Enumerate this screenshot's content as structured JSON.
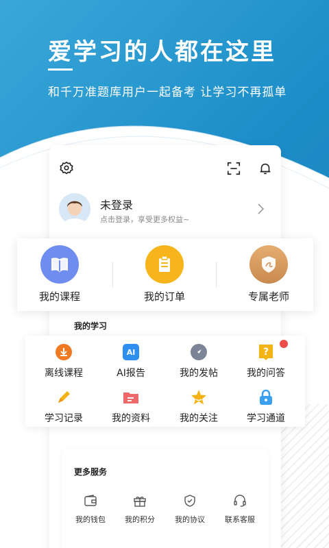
{
  "hero": {
    "title": "爱学习的人都在这里",
    "subtitle": "和千万准题库用户一起备考 让学习不再孤单"
  },
  "profile": {
    "name": "未登录",
    "tip": "点击登录，享受更多权益~"
  },
  "top_icons": [
    "settings-icon",
    "scan-icon",
    "bell-icon"
  ],
  "quick_links": [
    {
      "label": "我的课程",
      "icon": "book-icon",
      "color": "#6f8df0"
    },
    {
      "label": "我的订单",
      "icon": "clipboard-icon",
      "color": "#f7b51b"
    },
    {
      "label": "专属老师",
      "icon": "teacher-badge-icon",
      "color": "#d99b5c"
    }
  ],
  "study": {
    "title": "我的学习",
    "items": [
      {
        "label": "离线课程",
        "icon": "download-icon"
      },
      {
        "label": "AI报告",
        "icon": "ai-icon"
      },
      {
        "label": "我的发帖",
        "icon": "compass-icon"
      },
      {
        "label": "我的问答",
        "icon": "question-icon"
      },
      {
        "label": "学习记录",
        "icon": "pencil-icon"
      },
      {
        "label": "我的资料",
        "icon": "folder-icon"
      },
      {
        "label": "我的关注",
        "icon": "star-icon"
      },
      {
        "label": "学习通道",
        "icon": "lock-icon"
      }
    ],
    "ai_text": "AI"
  },
  "more": {
    "title": "更多服务",
    "items": [
      {
        "label": "我的钱包",
        "icon": "wallet-icon"
      },
      {
        "label": "我的积分",
        "icon": "gift-icon"
      },
      {
        "label": "我的协议",
        "icon": "shield-check-icon"
      },
      {
        "label": "联系客服",
        "icon": "headset-icon"
      }
    ]
  }
}
